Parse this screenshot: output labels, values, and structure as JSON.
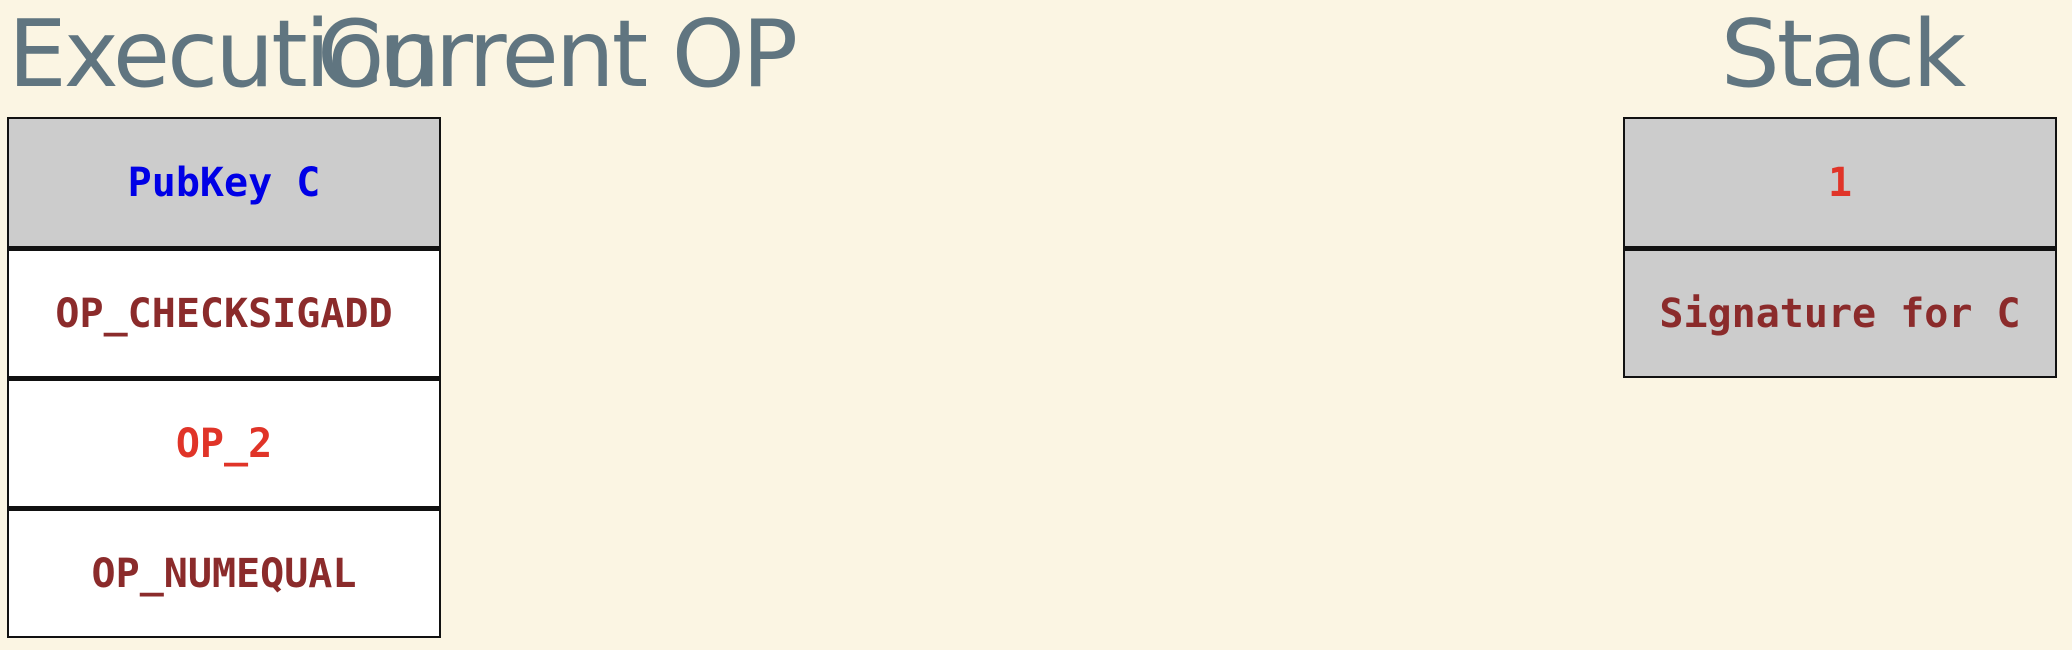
{
  "colors": {
    "background": "#fbf5e3",
    "heading": "#607580",
    "highlight_fill": "#cccccc",
    "plain_fill": "#ffffff",
    "data_blue": "#0000e6",
    "opcode_maroon": "#8b2b2b",
    "number_red": "#e03428"
  },
  "headings": {
    "execution": "Execution",
    "current_op": "Current OP",
    "stack": "Stack"
  },
  "execution": {
    "items": [
      {
        "label": "PubKey C",
        "fill": "#cccccc",
        "color": "#0000e6"
      },
      {
        "label": "OP_CHECKSIGADD",
        "fill": "#ffffff",
        "color": "#8b2b2b"
      },
      {
        "label": "OP_2",
        "fill": "#ffffff",
        "color": "#e03428"
      },
      {
        "label": "OP_NUMEQUAL",
        "fill": "#ffffff",
        "color": "#8b2b2b"
      }
    ]
  },
  "current_op": {
    "label": ""
  },
  "stack": {
    "items": [
      {
        "label": "1",
        "fill": "#cccccc",
        "color": "#e03428"
      },
      {
        "label": "Signature for C",
        "fill": "#cccccc",
        "color": "#8b2b2b"
      }
    ]
  }
}
